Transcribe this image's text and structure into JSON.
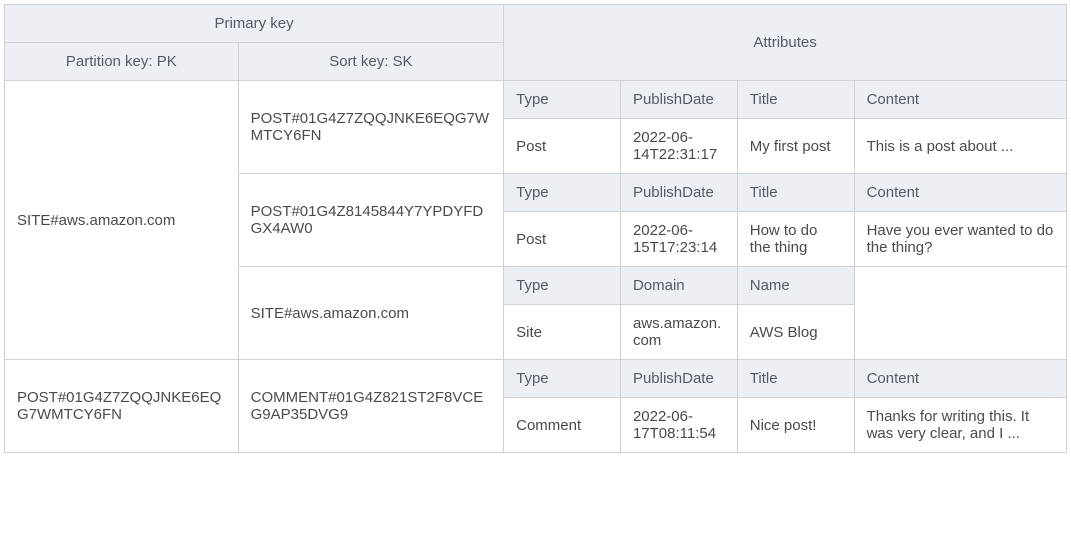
{
  "headers": {
    "primary_key": "Primary key",
    "attributes": "Attributes",
    "partition_key": "Partition key: PK",
    "sort_key": "Sort key: SK"
  },
  "groups": [
    {
      "pk": "SITE#aws.amazon.com",
      "rows": [
        {
          "sk": "POST#01G4Z7ZQQJNKE6EQG7WMTCY6FN",
          "attr_labels": [
            "Type",
            "PublishDate",
            "Title",
            "Content"
          ],
          "attr_values": [
            "Post",
            "2022-06-14T22:31:17",
            "My first post",
            "This is a post about ..."
          ]
        },
        {
          "sk": "POST#01G4Z8145844Y7YPDYFDGX4AW0",
          "attr_labels": [
            "Type",
            "PublishDate",
            "Title",
            "Content"
          ],
          "attr_values": [
            "Post",
            "2022-06-15T17:23:14",
            "How to do the thing",
            "Have you ever wanted to do the thing?"
          ]
        },
        {
          "sk": "SITE#aws.amazon.com",
          "attr_labels": [
            "Type",
            "Domain",
            "Name",
            ""
          ],
          "attr_values": [
            "Site",
            "aws.amazon.com",
            "AWS Blog",
            ""
          ]
        }
      ]
    },
    {
      "pk": "POST#01G4Z7ZQQJNKE6EQG7WMTCY6FN",
      "rows": [
        {
          "sk": "COMMENT#01G4Z821ST2F8VCEG9AP35DVG9",
          "attr_labels": [
            "Type",
            "PublishDate",
            "Title",
            "Content"
          ],
          "attr_values": [
            "Comment",
            "2022-06-17T08:11:54",
            "Nice post!",
            "Thanks for writing this. It was very clear, and I ..."
          ]
        }
      ]
    }
  ]
}
